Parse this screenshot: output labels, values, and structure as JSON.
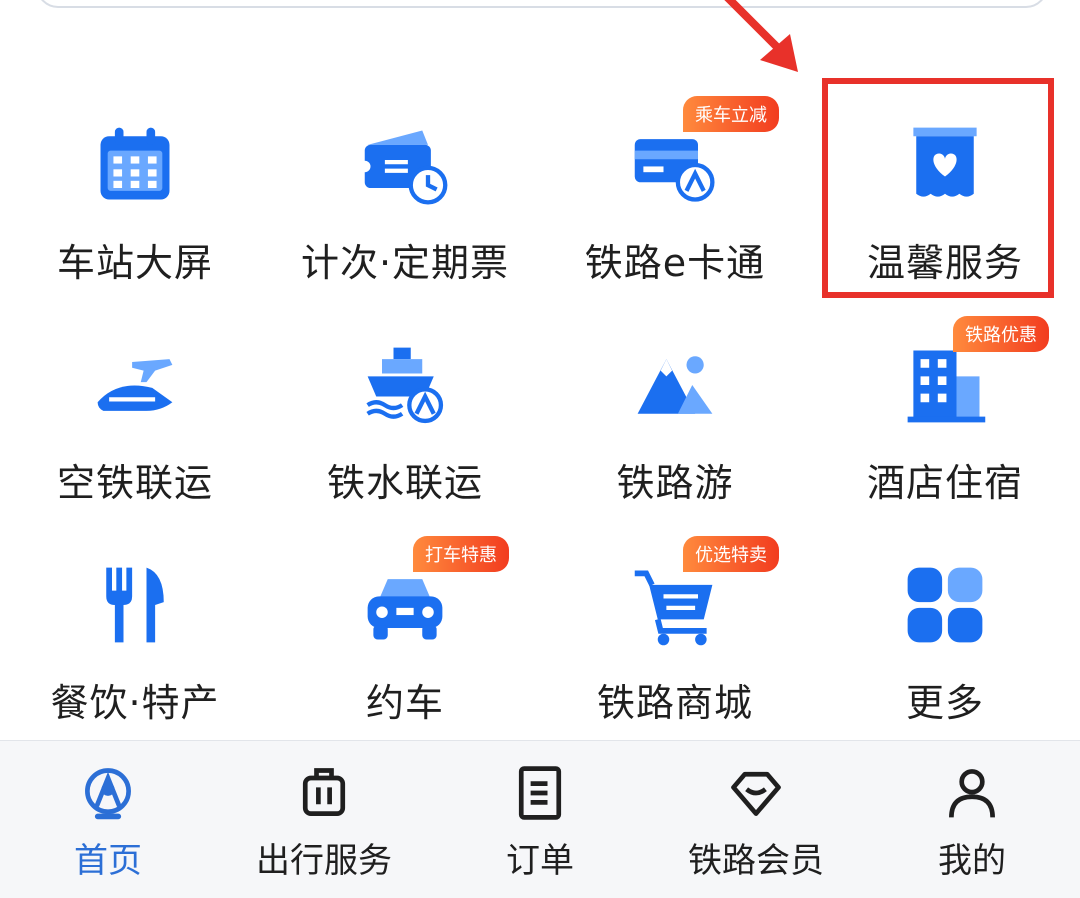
{
  "grid": {
    "items": [
      {
        "label": "车站大屏",
        "icon": "calendar-screen-icon"
      },
      {
        "label": "计次·定期票",
        "icon": "ticket-clock-icon"
      },
      {
        "label": "铁路e卡通",
        "icon": "card-train-icon",
        "badge": "乘车立减"
      },
      {
        "label": "温馨服务",
        "icon": "heart-service-icon",
        "highlighted": true
      },
      {
        "label": "空铁联运",
        "icon": "plane-train-icon"
      },
      {
        "label": "铁水联运",
        "icon": "ship-train-icon"
      },
      {
        "label": "铁路游",
        "icon": "mountain-travel-icon"
      },
      {
        "label": "酒店住宿",
        "icon": "hotel-building-icon",
        "badge": "铁路优惠"
      },
      {
        "label": "餐饮·特产",
        "icon": "fork-knife-icon"
      },
      {
        "label": "约车",
        "icon": "car-icon",
        "badge": "打车特惠"
      },
      {
        "label": "铁路商城",
        "icon": "shopping-cart-icon",
        "badge": "优选特卖"
      },
      {
        "label": "更多",
        "icon": "more-grid-icon"
      }
    ]
  },
  "tabbar": {
    "tabs": [
      {
        "label": "首页",
        "icon": "railway-logo-icon",
        "active": true
      },
      {
        "label": "出行服务",
        "icon": "luggage-icon"
      },
      {
        "label": "订单",
        "icon": "order-doc-icon"
      },
      {
        "label": "铁路会员",
        "icon": "diamond-member-icon"
      },
      {
        "label": "我的",
        "icon": "person-icon"
      }
    ]
  },
  "colors": {
    "primary": "#1b6ff0",
    "highlight": "#e8312a",
    "active_tab": "#2c6fd6"
  }
}
